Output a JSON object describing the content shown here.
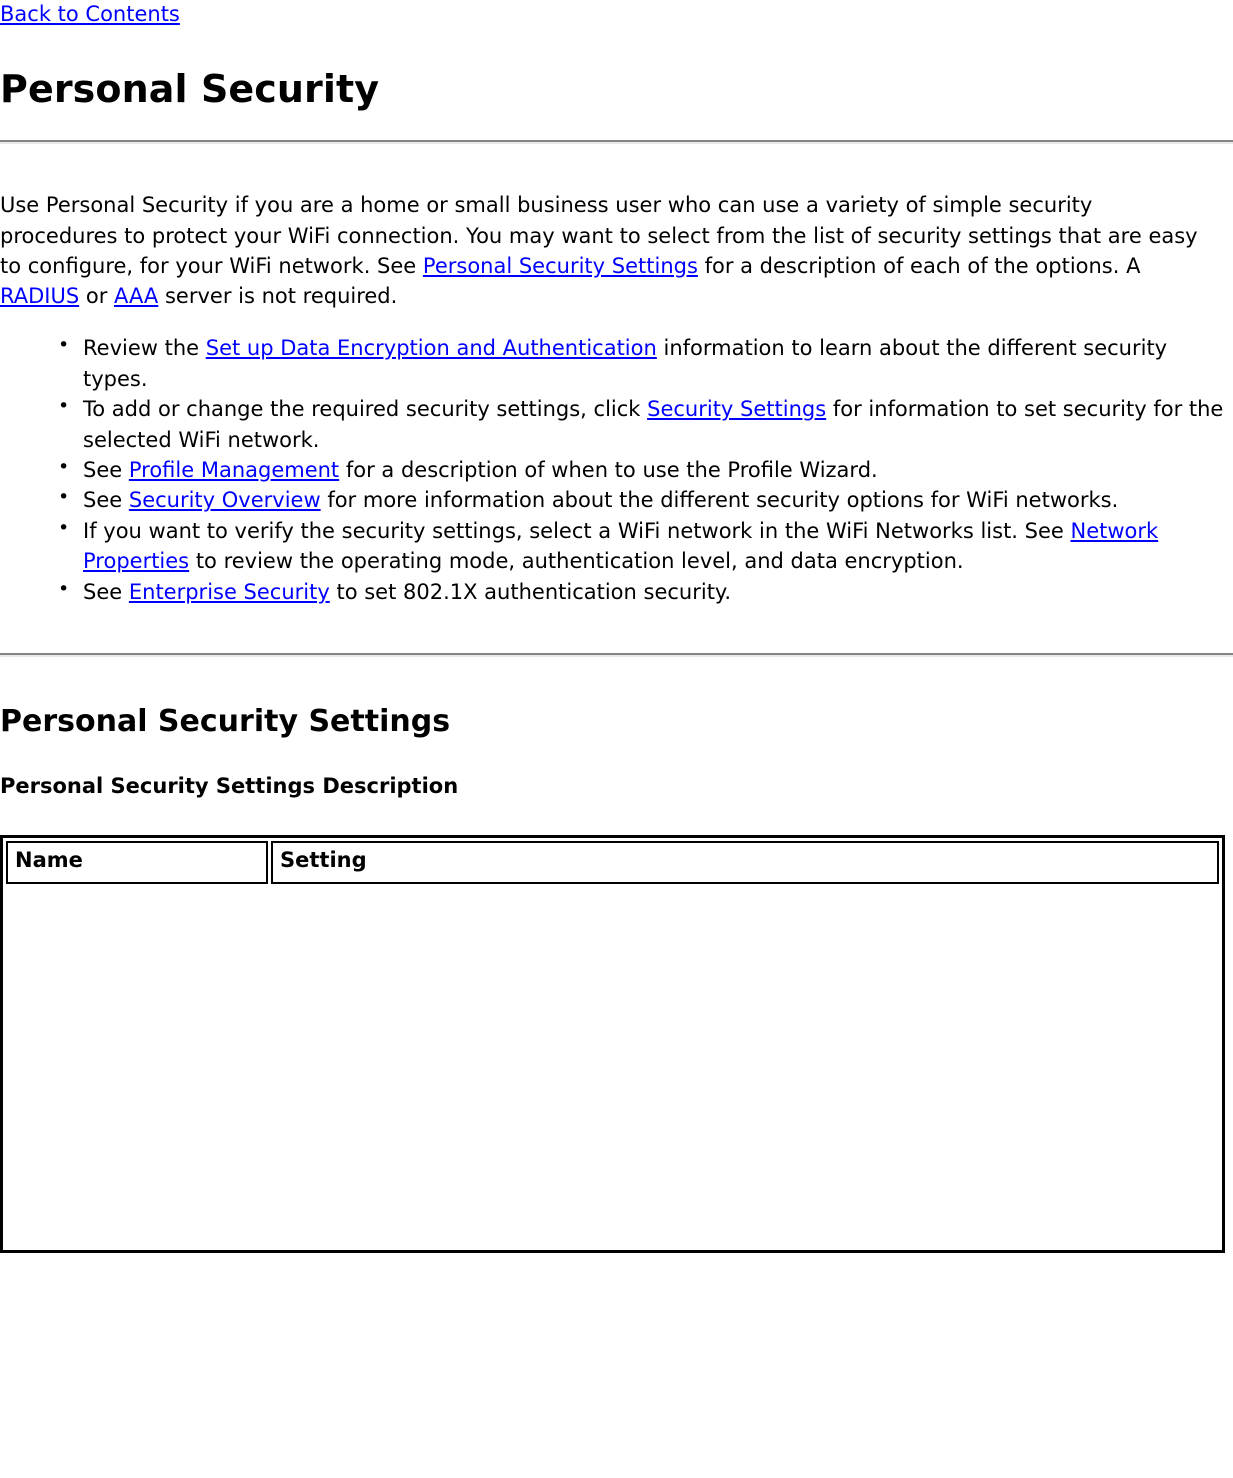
{
  "nav": {
    "back_link": "Back to Contents"
  },
  "header": {
    "title": "Personal Security"
  },
  "intro": {
    "part1": "Use Personal Security if you are a home or small business user who can use a variety of simple security procedures to protect your WiFi connection. You may want to select from the list of security settings that are easy to configure, for your WiFi network. See ",
    "link_personal_security_settings": "Personal Security Settings",
    "part2": " for a description of each of the options. A ",
    "link_radius": "RADIUS",
    "part3": " or ",
    "link_aaa": "AAA",
    "part4": " server is not required."
  },
  "bullets": [
    {
      "pre": "Review the ",
      "link": "Set up Data Encryption and Authentication",
      "post": " information to learn about the different security types."
    },
    {
      "pre": "To add or change the required security settings, click ",
      "link": "Security Settings",
      "post": " for information to set security for the selected WiFi network."
    },
    {
      "pre": "See ",
      "link": "Profile Management",
      "post": " for a description of when to use the Profile Wizard."
    },
    {
      "pre": "See ",
      "link": "Security Overview",
      "post": " for more information about the different security options for WiFi networks."
    },
    {
      "pre": "If you want to verify the security settings, select a WiFi network in the WiFi Networks list. See ",
      "link": "Network Properties",
      "post": " to review the operating mode, authentication level, and data encryption."
    },
    {
      "pre": "See ",
      "link": "Enterprise Security",
      "post": " to set 802.1X authentication security."
    }
  ],
  "section": {
    "title": "Personal Security Settings",
    "caption": "Personal Security Settings Description"
  },
  "table": {
    "columns": [
      "Name",
      "Setting"
    ],
    "rows": []
  },
  "colors": {
    "link": "#0000ff",
    "text": "#000000",
    "rule_dark": "#848484",
    "rule_light": "#e9e9e9",
    "table_border": "#000000",
    "background": "#ffffff"
  }
}
